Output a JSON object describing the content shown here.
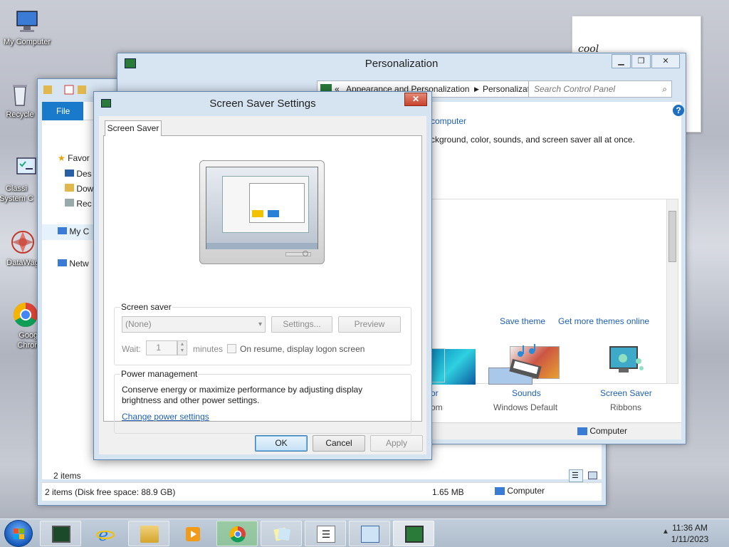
{
  "desktop": {
    "icons": [
      {
        "label": "My Computer",
        "icon": "computer-icon"
      },
      {
        "label": "Recycle",
        "icon": "recycle-bin-icon"
      },
      {
        "label": "Classi System C",
        "icon": "control-panel-icon"
      },
      {
        "label": "DataWag",
        "icon": "datawag-icon"
      },
      {
        "label": "Googl Chrom",
        "icon": "chrome-icon"
      }
    ],
    "sticky_note": "cool"
  },
  "explorer": {
    "file_tab": "File",
    "nav": [
      "Favor",
      "Des",
      "Dow",
      "Rec",
      "My C",
      "Netw"
    ],
    "items_count": "2 items",
    "status_left": "2 items (Disk free space: 88.9 GB)",
    "status_size": "1.65 MB",
    "status_location": "Computer"
  },
  "personalization": {
    "title": "Personalization",
    "breadcrumb_prefix": "«",
    "breadcrumb_1": "Appearance and Personalization",
    "breadcrumb_2": "Personalization",
    "search_placeholder": "Search Control Panel",
    "computer_link": "computer",
    "description": "ckground, color, sounds, and screen saver all at once.",
    "save_theme": "Save theme",
    "get_more_themes": "Get more themes online",
    "color_label_partial": "or",
    "color_sub_partial": "om",
    "sounds_label": "Sounds",
    "sounds_value": "Windows Default",
    "screensaver_label": "Screen Saver",
    "screensaver_value": "Ribbons",
    "status_location": "Computer"
  },
  "dialog": {
    "title": "Screen Saver Settings",
    "tab_label": "Screen Saver",
    "screensaver_group": "Screen saver",
    "screensaver_selected": "(None)",
    "settings_button": "Settings...",
    "preview_button": "Preview",
    "wait_label": "Wait:",
    "wait_value": "1",
    "minutes_label": "minutes",
    "resume_label": "On resume, display logon screen",
    "power_group": "Power management",
    "power_text": "Conserve energy or maximize performance by adjusting display brightness and other power settings.",
    "power_link": "Change power settings",
    "ok": "OK",
    "cancel": "Cancel",
    "apply": "Apply"
  },
  "taskbar": {
    "apps": [
      "start-orb",
      "task-manager",
      "internet-explorer",
      "file-explorer",
      "media-player",
      "chrome",
      "sticky-notes",
      "notepad-list",
      "control-panel",
      "personalization"
    ],
    "time": "11:36 AM",
    "date": "1/11/2023"
  },
  "colors": {
    "link": "#1e5fb4",
    "file_tab": "#1979ca",
    "title_bar": "#d7e4f2",
    "close_button": "#c7422c"
  }
}
